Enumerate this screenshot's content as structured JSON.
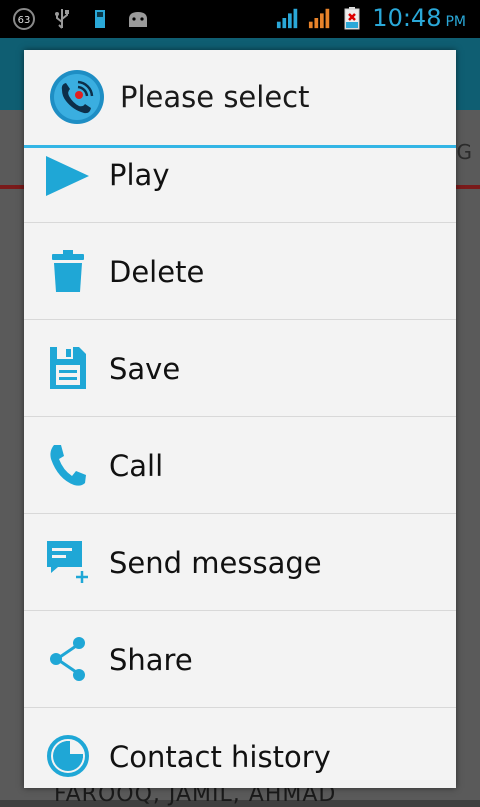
{
  "status_bar": {
    "battery_level": "63",
    "time": "10:48",
    "ampm": "PM",
    "icons": [
      "battery-63-icon",
      "usb-icon",
      "sd-card-icon",
      "android-debug-icon",
      "signal-blue-icon",
      "signal-orange-icon",
      "battery-charging-icon"
    ],
    "accent_color": "#2aa8d8"
  },
  "background_app": {
    "tab_letter": "G",
    "bottom_text": "FAROOQ, JAMIL, AHMAD"
  },
  "dialog": {
    "title": "Please select",
    "accent_color": "#33b5e5",
    "items": [
      {
        "label": "Play",
        "icon": "play-icon"
      },
      {
        "label": "Delete",
        "icon": "trash-icon"
      },
      {
        "label": "Save",
        "icon": "floppy-disk-icon"
      },
      {
        "label": "Call",
        "icon": "phone-icon"
      },
      {
        "label": "Send message",
        "icon": "new-message-icon"
      },
      {
        "label": "Share",
        "icon": "share-icon"
      },
      {
        "label": "Contact history",
        "icon": "history-chart-icon"
      }
    ]
  }
}
